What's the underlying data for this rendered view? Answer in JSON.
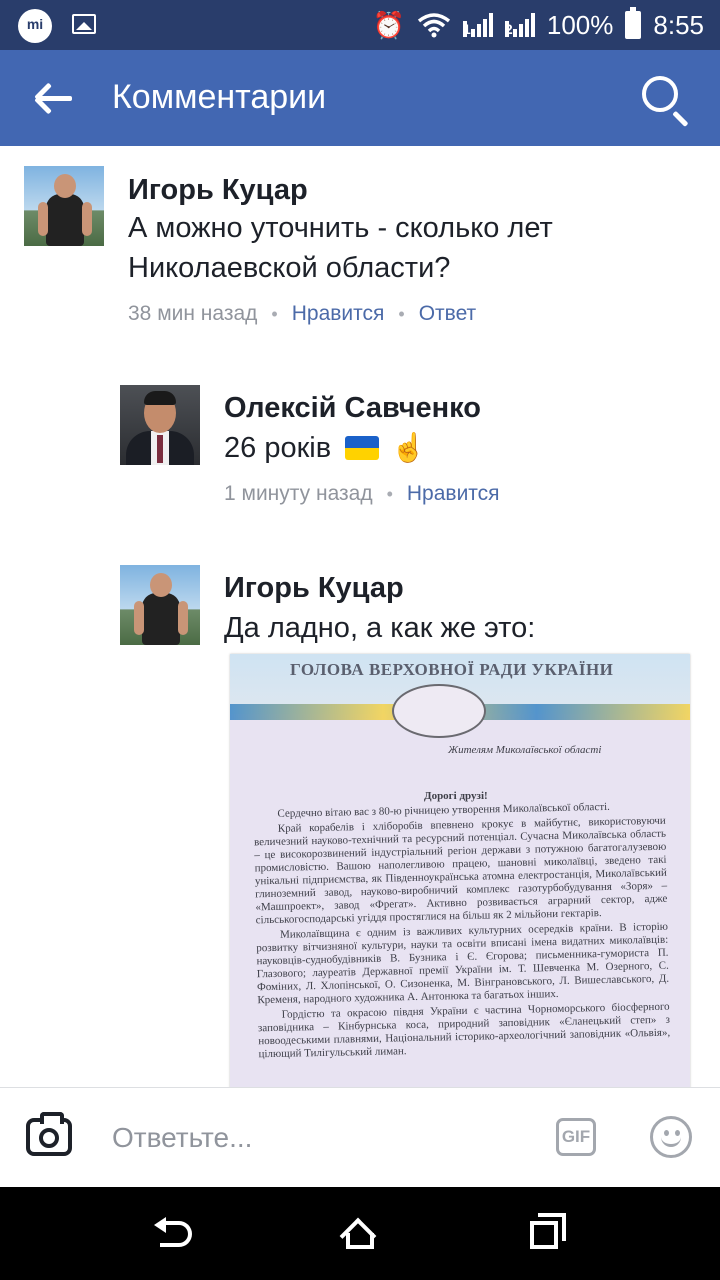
{
  "status_bar": {
    "icons": [
      "mi-icon",
      "gallery-icon",
      "alarm-icon",
      "wifi-icon",
      "signal-1-icon",
      "signal-2-icon",
      "battery-icon"
    ],
    "signal1_label": "1",
    "signal2_label": "2",
    "battery_text": "100%",
    "time": "8:55"
  },
  "app_bar": {
    "title": "Комментарии",
    "back_icon": "arrow-left-icon",
    "search_icon": "search-icon"
  },
  "comments": [
    {
      "author": "Игорь Куцар",
      "text": "А можно уточнить - сколько лет Николаевской области?",
      "time": "38 мин назад",
      "like": "Нравится",
      "reply": "Ответ"
    },
    {
      "author": "Олексій Савченко",
      "text": "26 років",
      "emoji": [
        "ukraine-flag-icon",
        "pointing-up-icon"
      ],
      "time": "1 минуту назад",
      "like": "Нравится"
    },
    {
      "author": "Игорь Куцар",
      "text": "Да ладно, а как же это:",
      "attachment": {
        "heading": "ГОЛОВА ВЕРХОВНОЇ РАДИ УКРАЇНИ",
        "addressee": "Жителям Миколаївської області",
        "greeting": "Дорогі друзі!",
        "paragraphs": [
          "Сердечно вітаю вас з 80-ю річницею утворення Миколаївської області.",
          "Край корабелів і хліборобів впевнено крокує в майбутнє, використовуючи величезний науково-технічний та ресурсний потенціал. Сучасна Миколаївська область – це високорозвинений індустріальний регіон держави з потужною багатогалузевою промисловістю. Вашою наполегливою працею, шановні миколаївці, зведено такі унікальні підприємства, як Південноукраїнська атомна електростанція, Миколаївський глиноземний завод, науково-виробничий комплекс газотурбобудування «Зоря» – «Машпроект», завод «Фрегат». Активно розвивається аграрний сектор, адже сільськогосподарські угіддя простяглися на більш як 2 мільйони гектарів.",
          "Миколаївщина є одним із важливих культурних осередків країни. В історію розвитку вітчизняної культури, науки та освіти вписані імена видатних миколаївців: науковців-суднобудівників В. Бузника і Є. Єгорова; письменника-гумориста П. Глазового; лауреатів Державної премії України ім. Т. Шевченка М. Озерного, С. Фоміних, Л. Хлопінської, О. Сизоненка, М. Вінграновського, Л. Вишеславського, Д. Кременя, народного художника А. Антонюка та багатьох інших.",
          "Гордістю та окрасою півдня України є частина Чорноморського біосферного заповідника – Кінбурнська коса, природний заповідник «Єланецький степ» з новоодеськими плавнями, Національний історико-археологічний заповідник «Ольвія», цілющий Тилігульський лиман."
        ]
      }
    }
  ],
  "reply_bar": {
    "placeholder": "Ответьте...",
    "camera_icon": "camera-icon",
    "gif_label": "GIF",
    "emoji_icon": "smiley-icon"
  },
  "nav_bar": {
    "icons": [
      "back-nav-icon",
      "home-icon",
      "recents-icon"
    ]
  }
}
